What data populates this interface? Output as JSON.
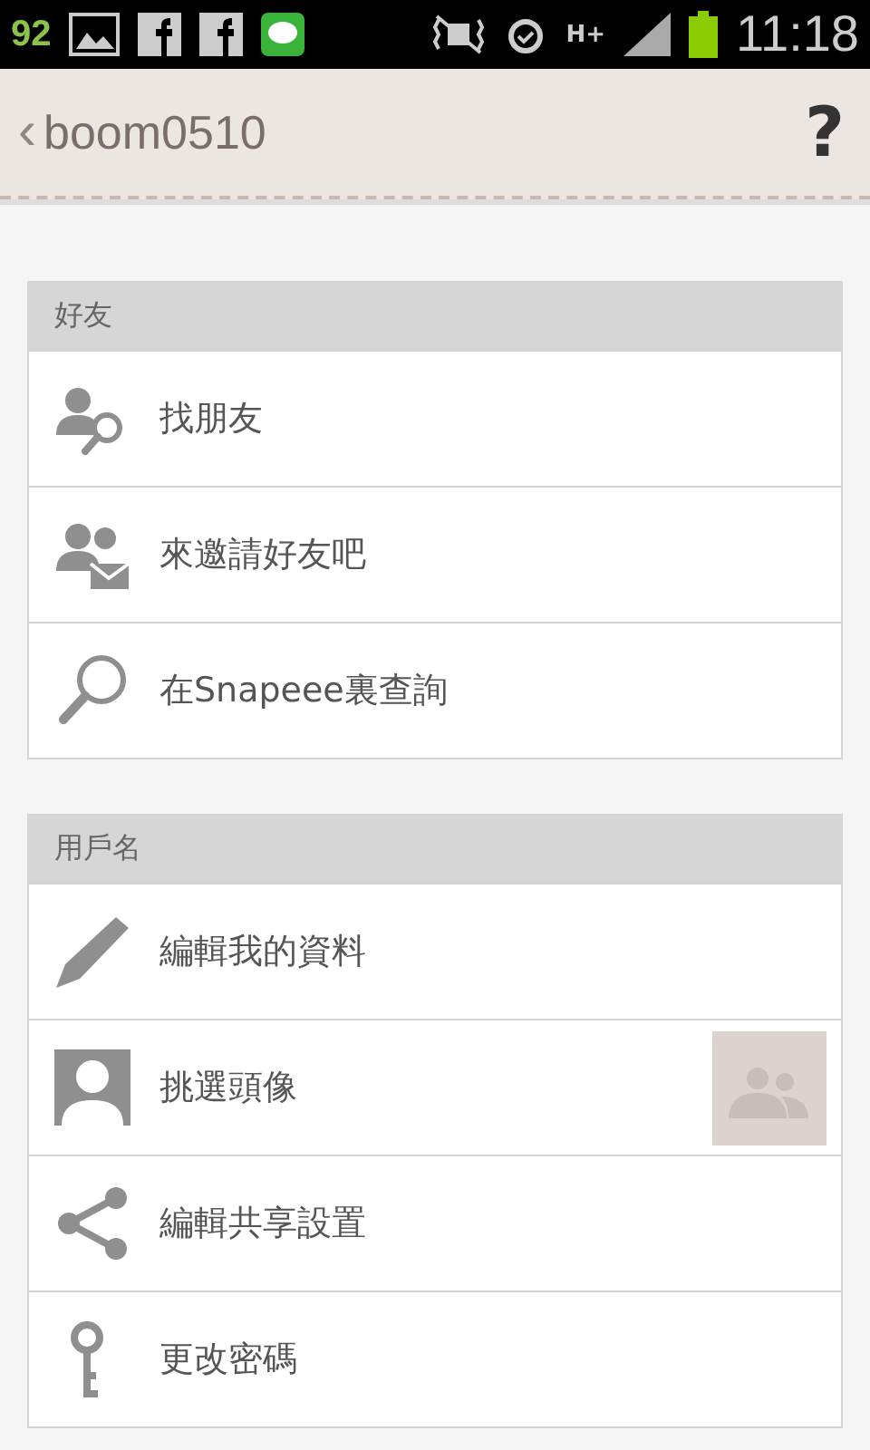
{
  "status_bar": {
    "battery_number": "92",
    "network": "H+",
    "time": "11:18"
  },
  "header": {
    "back": "‹",
    "title": "boom0510",
    "help": "?"
  },
  "sections": [
    {
      "title": "好友",
      "items": [
        {
          "kind": "find-friends",
          "label": "找朋友"
        },
        {
          "kind": "invite",
          "label": "來邀請好友吧"
        },
        {
          "kind": "search",
          "label": "在Snapeee裏查詢"
        }
      ]
    },
    {
      "title": "用戶名",
      "items": [
        {
          "kind": "edit",
          "label": "編輯我的資料"
        },
        {
          "kind": "avatar",
          "label": "挑選頭像"
        },
        {
          "kind": "share",
          "label": "編輯共享設置"
        },
        {
          "kind": "key",
          "label": "更改密碼"
        }
      ]
    }
  ]
}
